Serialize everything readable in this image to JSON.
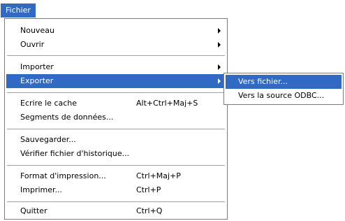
{
  "menubar": {
    "fichier": "Fichier"
  },
  "menu": {
    "items": [
      {
        "label": "Nouveau",
        "shortcut": ""
      },
      {
        "label": "Ouvrir",
        "shortcut": ""
      },
      {
        "label": "Importer",
        "shortcut": ""
      },
      {
        "label": "Exporter",
        "shortcut": ""
      },
      {
        "label": "Ecrire le cache",
        "shortcut": "Alt+Ctrl+Maj+S"
      },
      {
        "label": "Segments de données...",
        "shortcut": ""
      },
      {
        "label": "Sauvegarder...",
        "shortcut": ""
      },
      {
        "label": "Vérifier fichier d'historique...",
        "shortcut": ""
      },
      {
        "label": "Format d'impression...",
        "shortcut": "Ctrl+Maj+P"
      },
      {
        "label": "Imprimer...",
        "shortcut": "Ctrl+P"
      },
      {
        "label": "Quitter",
        "shortcut": "Ctrl+Q"
      }
    ],
    "highlighted": "Exporter"
  },
  "submenu": {
    "items": [
      {
        "label": "Vers fichier..."
      },
      {
        "label": "Vers la source ODBC..."
      }
    ],
    "highlighted": "Vers fichier..."
  },
  "colors": {
    "highlight": "#316ac5",
    "border": "#7b7b7b",
    "separator": "#a0a0a0"
  }
}
